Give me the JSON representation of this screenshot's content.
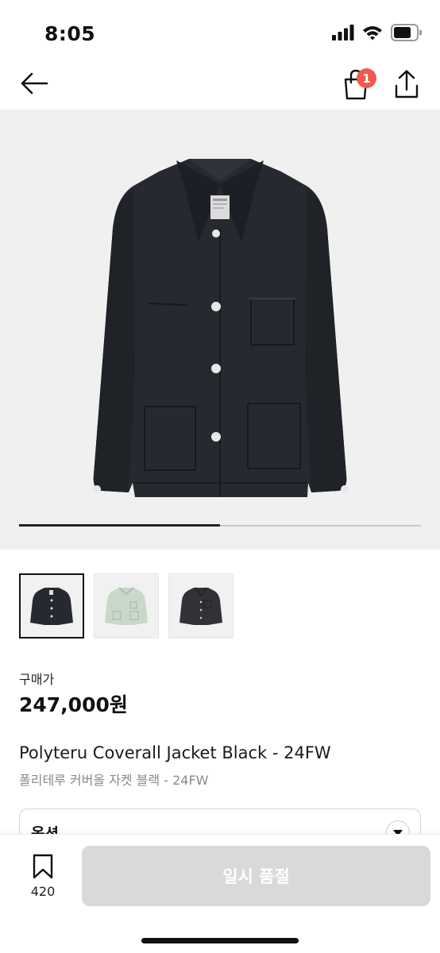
{
  "status_bar": {
    "time": "8:05",
    "icons": [
      "cellular-signal-icon",
      "wifi-icon",
      "battery-icon"
    ]
  },
  "nav": {
    "back_icon": "arrow-left-icon",
    "cart_icon": "shopping-bag-icon",
    "cart_badge": "1",
    "share_icon": "share-upload-icon",
    "badge_color": "#ef5a4f"
  },
  "gallery": {
    "image_position": 1,
    "image_count": 2,
    "progress_fraction": 0.5,
    "thumbnails": [
      {
        "label": "black jacket thumbnail",
        "selected": true
      },
      {
        "label": "light green jacket thumbnail",
        "selected": false
      },
      {
        "label": "charcoal jacket thumbnail",
        "selected": false
      }
    ]
  },
  "product": {
    "price_label": "구매가",
    "price": "247,000원",
    "title_en": "Polyteru Coverall Jacket Black - 24FW",
    "title_ko": "폴리테루 커버올 자켓 블랙 - 24FW"
  },
  "option": {
    "label": "옵션",
    "toggle_icon": "chevron-down-icon"
  },
  "bottom_bar": {
    "bookmark_icon": "bookmark-icon",
    "bookmark_count": "420",
    "button_label": "일시 품절",
    "button_color": "#d9d9d9"
  }
}
